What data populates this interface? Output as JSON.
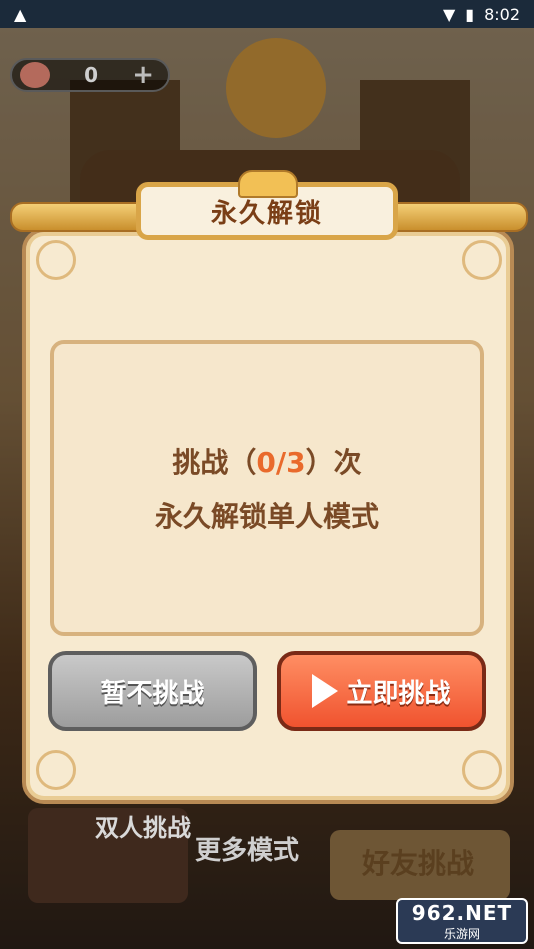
{
  "status_bar": {
    "time": "8:02",
    "warning_icon": "warning-icon",
    "wifi_icon": "wifi-icon",
    "battery_icon": "battery-icon"
  },
  "counter": {
    "value": "0",
    "icon": "peach-icon",
    "plus": "+"
  },
  "background": {
    "duo_label": "双人挑战",
    "more_mode_label": "更多模式",
    "friend_challenge": "好友挑战"
  },
  "modal": {
    "title": "永久解锁",
    "line1_prefix": "挑战（",
    "line1_count": "0/3",
    "line1_suffix": "）次",
    "line2": "永久解锁单人模式",
    "later_button": "暂不挑战",
    "now_button": "立即挑战"
  },
  "watermark": {
    "top": "962.NET",
    "bottom": "乐游网"
  }
}
